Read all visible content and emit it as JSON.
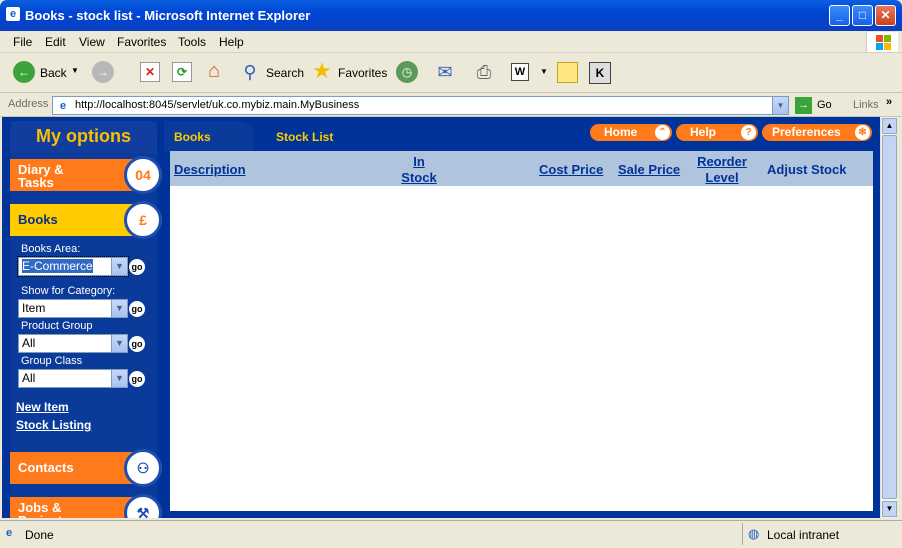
{
  "window": {
    "title": "Books - stock list - Microsoft Internet Explorer",
    "minimize": "_",
    "maximize": "□",
    "close": "✕"
  },
  "menu": [
    "File",
    "Edit",
    "View",
    "Favorites",
    "Tools",
    "Help"
  ],
  "toolbar": {
    "back": "Back",
    "search": "Search",
    "favorites": "Favorites"
  },
  "address": {
    "label": "Address",
    "url": "http://localhost:8045/servlet/uk.co.mybiz.main.MyBusiness",
    "go": "Go",
    "links": "Links"
  },
  "sidebar": {
    "title": "My options",
    "diary": "Diary & Tasks",
    "diary_icon_text": "04",
    "books": "Books",
    "books_icon_text": "£",
    "books_area_label": "Books Area:",
    "books_area_value": "E-Commerce",
    "category_label": "Show for Category:",
    "category_value": "Item",
    "product_group_label": "Product Group",
    "product_group_value": "All",
    "group_class_label": "Group Class",
    "group_class_value": "All",
    "go": "go",
    "new_item": "New Item",
    "stock_listing": "Stock Listing",
    "contacts": "Contacts",
    "jobs": "Jobs & Projects"
  },
  "tabs": {
    "books": "Books",
    "stock_list": "Stock List"
  },
  "header_buttons": {
    "home": "Home",
    "help": "Help",
    "preferences": "Preferences"
  },
  "table": {
    "columns": [
      "Description",
      "In Stock",
      "Cost Price",
      "Sale Price",
      "Reorder Level",
      "Adjust Stock"
    ],
    "rows": []
  },
  "status": {
    "text": "Done",
    "zone": "Local intranet"
  }
}
